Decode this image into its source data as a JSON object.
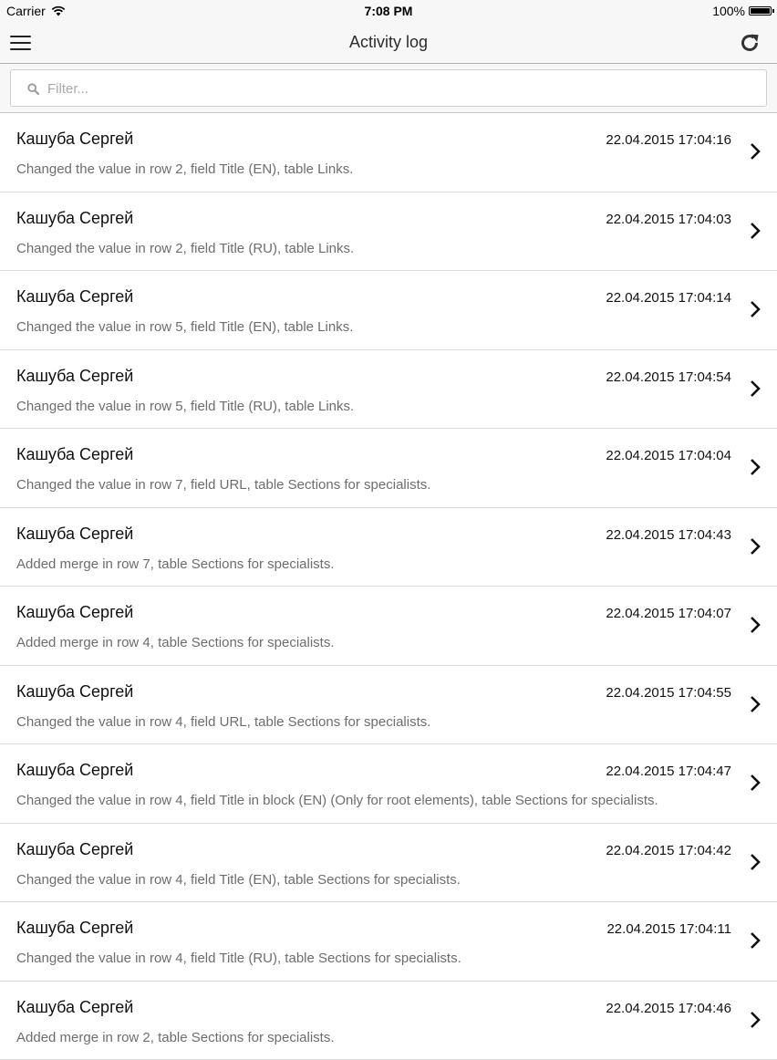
{
  "status_bar": {
    "carrier": "Carrier",
    "time": "7:08 PM",
    "battery": "100%"
  },
  "nav": {
    "title": "Activity log",
    "menu_icon": "hamburger-menu-icon",
    "refresh_icon": "refresh-icon"
  },
  "filter": {
    "placeholder": "Filter...",
    "value": ""
  },
  "entries": [
    {
      "user": "Кашуба Сергей",
      "date": "22.04.2015 17:04:16",
      "desc": "Changed the value in row 2, field Title (EN), table Links."
    },
    {
      "user": "Кашуба Сергей",
      "date": "22.04.2015 17:04:03",
      "desc": "Changed the value in row 2, field Title (RU), table Links."
    },
    {
      "user": "Кашуба Сергей",
      "date": "22.04.2015 17:04:14",
      "desc": "Changed the value in row 5, field Title (EN), table Links."
    },
    {
      "user": "Кашуба Сергей",
      "date": "22.04.2015 17:04:54",
      "desc": "Changed the value in row 5, field Title (RU), table Links."
    },
    {
      "user": "Кашуба Сергей",
      "date": "22.04.2015 17:04:04",
      "desc": "Changed the value in row 7, field URL, table Sections for specialists."
    },
    {
      "user": "Кашуба Сергей",
      "date": "22.04.2015 17:04:43",
      "desc": "Added merge in row 7, table Sections for specialists."
    },
    {
      "user": "Кашуба Сергей",
      "date": "22.04.2015 17:04:07",
      "desc": "Added merge in row 4, table Sections for specialists."
    },
    {
      "user": "Кашуба Сергей",
      "date": "22.04.2015 17:04:55",
      "desc": "Changed the value in row 4, field URL, table Sections for specialists."
    },
    {
      "user": "Кашуба Сергей",
      "date": "22.04.2015 17:04:47",
      "desc": "Changed the value in row 4, field Title in block (EN) (Only for root elements), table Sections for specialists."
    },
    {
      "user": "Кашуба Сергей",
      "date": "22.04.2015 17:04:42",
      "desc": "Changed the value in row 4, field Title (EN), table Sections for specialists."
    },
    {
      "user": "Кашуба Сергей",
      "date": "22.04.2015 17:04:11",
      "desc": "Changed the value in row 4, field Title (RU), table Sections for specialists."
    },
    {
      "user": "Кашуба Сергей",
      "date": "22.04.2015 17:04:46",
      "desc": "Added merge in row 2, table Sections for specialists."
    }
  ]
}
